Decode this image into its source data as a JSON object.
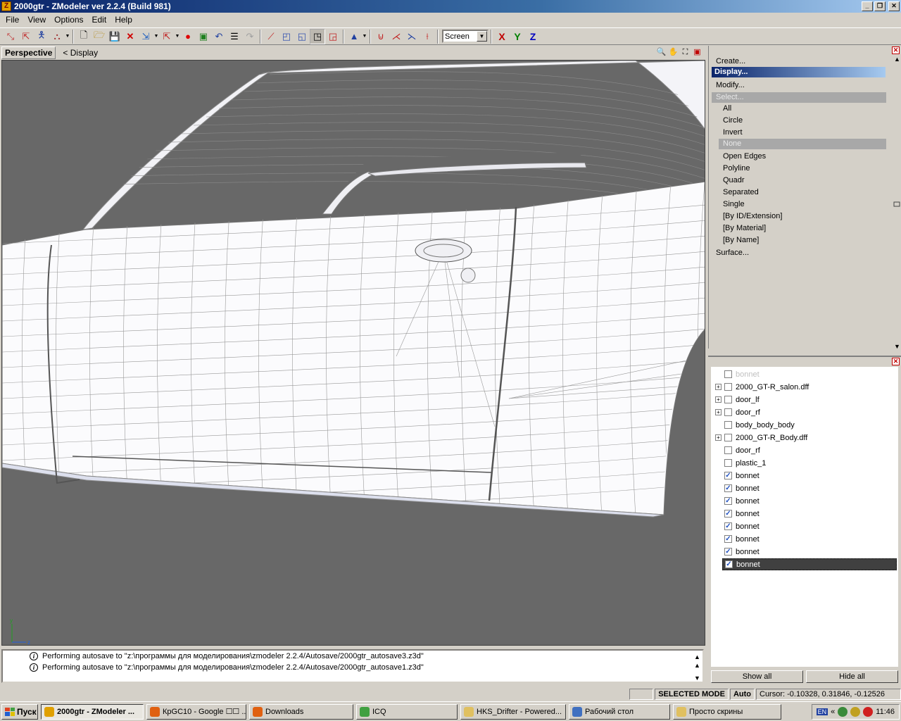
{
  "window": {
    "title": "2000gtr - ZModeler ver 2.2.4 (Build 981)",
    "icon_letter": "Z"
  },
  "menu": [
    "File",
    "View",
    "Options",
    "Edit",
    "Help"
  ],
  "toolbar": {
    "coord_mode": "Screen",
    "axes": [
      "X",
      "Y",
      "Z"
    ],
    "axis_colors": [
      "#c00000",
      "#008000",
      "#0000c0"
    ]
  },
  "viewport": {
    "title": "Perspective",
    "breadcrumb": "< Display",
    "gizmo_y": "y",
    "gizmo_z": "z"
  },
  "command_panel": {
    "top_items": [
      "Create...",
      "Display...",
      "Modify..."
    ],
    "select_label": "Select...",
    "select_items": [
      "All",
      "Circle",
      "Invert",
      "None",
      "Open Edges",
      "Polyline",
      "Quadr",
      "Separated",
      "Single",
      "[By ID/Extension]",
      "[By Material]",
      "[By Name]"
    ],
    "bottom_item": "Surface..."
  },
  "objects": [
    {
      "name": "bonnet",
      "expandable": false,
      "checked": false,
      "faded": true
    },
    {
      "name": "2000_GT-R_salon.dff",
      "expandable": true,
      "checked": false
    },
    {
      "name": "door_lf",
      "expandable": true,
      "checked": false
    },
    {
      "name": "door_rf",
      "expandable": true,
      "checked": false
    },
    {
      "name": "body_body_body",
      "expandable": false,
      "checked": false
    },
    {
      "name": "2000_GT-R_Body.dff",
      "expandable": true,
      "checked": false
    },
    {
      "name": "door_rf",
      "expandable": false,
      "checked": false
    },
    {
      "name": "plastic_1",
      "expandable": false,
      "checked": false
    },
    {
      "name": "bonnet",
      "expandable": false,
      "checked": true
    },
    {
      "name": "bonnet",
      "expandable": false,
      "checked": true
    },
    {
      "name": "bonnet",
      "expandable": false,
      "checked": true
    },
    {
      "name": "bonnet",
      "expandable": false,
      "checked": true
    },
    {
      "name": "bonnet",
      "expandable": false,
      "checked": true
    },
    {
      "name": "bonnet",
      "expandable": false,
      "checked": true
    },
    {
      "name": "bonnet",
      "expandable": false,
      "checked": true
    },
    {
      "name": "bonnet",
      "expandable": false,
      "checked": true,
      "selected": true
    }
  ],
  "object_buttons": {
    "show_all": "Show all",
    "hide_all": "Hide all"
  },
  "log": [
    "Performing autosave to \"z:\\программы для моделирования\\zmodeler 2.2.4/Autosave/2000gtr_autosave3.z3d\"",
    "Performing autosave to \"z:\\программы для моделирования\\zmodeler 2.2.4/Autosave/2000gtr_autosave1.z3d\""
  ],
  "status": {
    "mode": "SELECTED MODE",
    "auto": "Auto",
    "cursor": "Cursor: -0.10328, 0.31846, -0.12526"
  },
  "taskbar": {
    "start": "Пуск",
    "tasks": [
      {
        "label": "2000gtr - ZModeler ...",
        "active": true,
        "color": "#e0a000"
      },
      {
        "label": "КрGC10 - Google ☐☐ ...",
        "active": false,
        "color": "#e06010"
      },
      {
        "label": "Downloads",
        "active": false,
        "color": "#e06010"
      },
      {
        "label": "ICQ",
        "active": false,
        "color": "#40a040"
      },
      {
        "label": "HKS_Drifter - Powered...",
        "active": false,
        "color": "#e0c060"
      },
      {
        "label": "Рабочий стол",
        "active": false,
        "color": "#4070c0"
      },
      {
        "label": "Просто скрины",
        "active": false,
        "color": "#e0c060"
      }
    ],
    "lang": "EN",
    "clock": "11:46"
  }
}
